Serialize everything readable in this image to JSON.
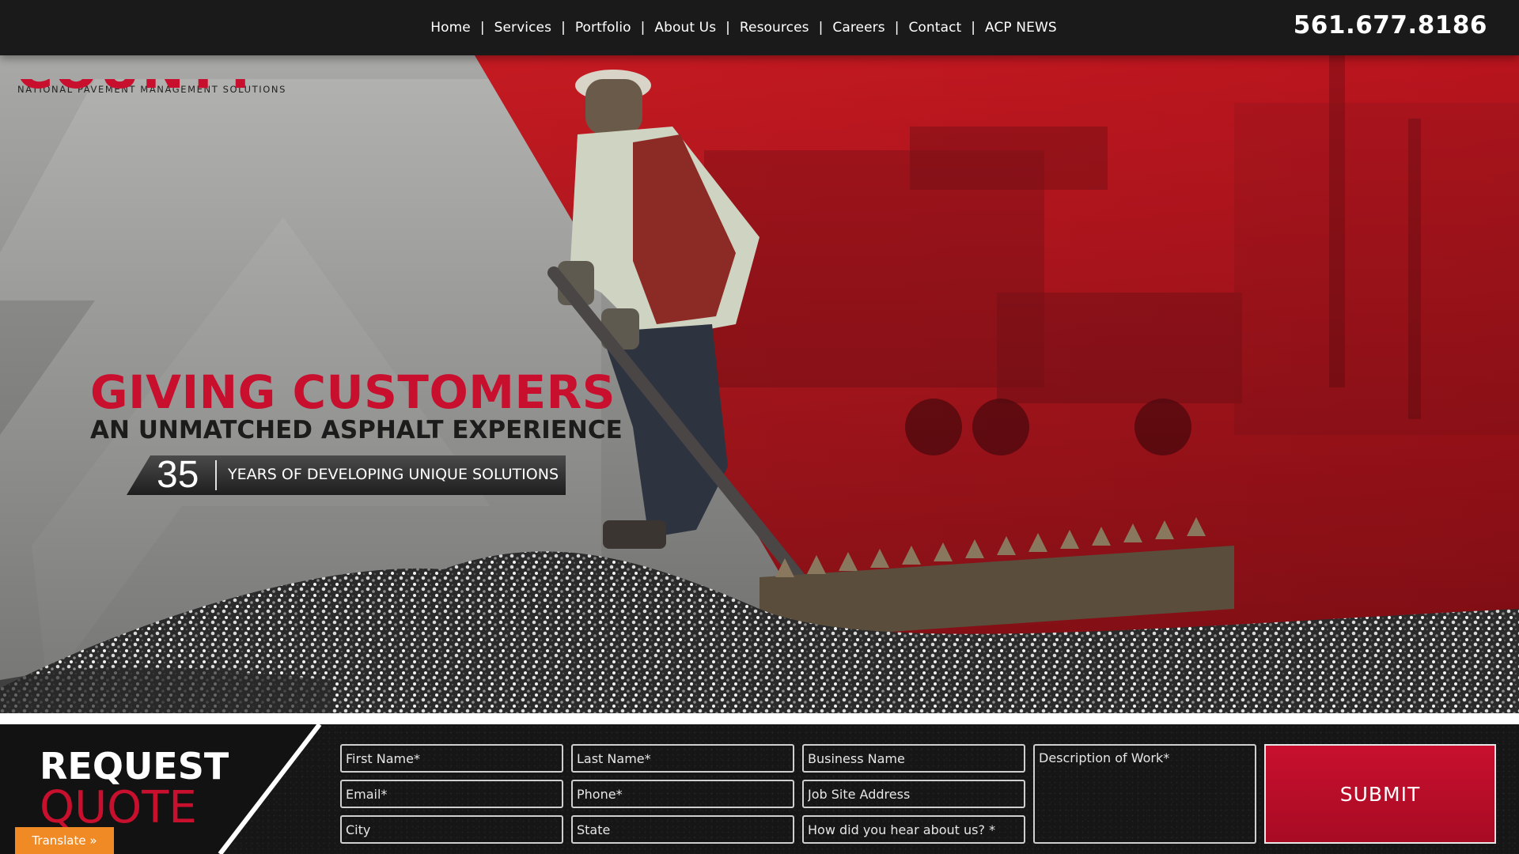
{
  "nav": {
    "items": [
      {
        "label": "Home"
      },
      {
        "label": "Services"
      },
      {
        "label": "Portfolio"
      },
      {
        "label": "About Us"
      },
      {
        "label": "Resources"
      },
      {
        "label": "Careers"
      },
      {
        "label": "Contact"
      },
      {
        "label": "ACP NEWS"
      }
    ],
    "separator": "|",
    "phone": "561.677.8186"
  },
  "logo": {
    "wordmark": "COUNTY",
    "tagline": "NATIONAL PAVEMENT MANAGEMENT SOLUTIONS"
  },
  "hero": {
    "headline": "GIVING CUSTOMERS",
    "subhead": "AN UNMATCHED ASPHALT EXPERIENCE",
    "years_number": "35",
    "years_text": "YEARS OF DEVELOPING UNIQUE SOLUTIONS"
  },
  "quote": {
    "title_line1": "REQUEST",
    "title_line2": "QUOTE",
    "fields": {
      "first_name": "First Name*",
      "last_name": "Last Name*",
      "business_name": "Business Name",
      "email": "Email*",
      "phone": "Phone*",
      "job_site": "Job Site Address",
      "city": "City",
      "state": "State",
      "referral": "How did you hear about us? *",
      "description": "Description of Work*"
    },
    "submit_label": "SUBMIT"
  },
  "translate_label": "Translate »",
  "colors": {
    "brand_red": "#c8102e",
    "nav_bg": "#1a1a1a",
    "hero_gray": "#a9a9a7",
    "translate_orange": "#f08a24"
  }
}
